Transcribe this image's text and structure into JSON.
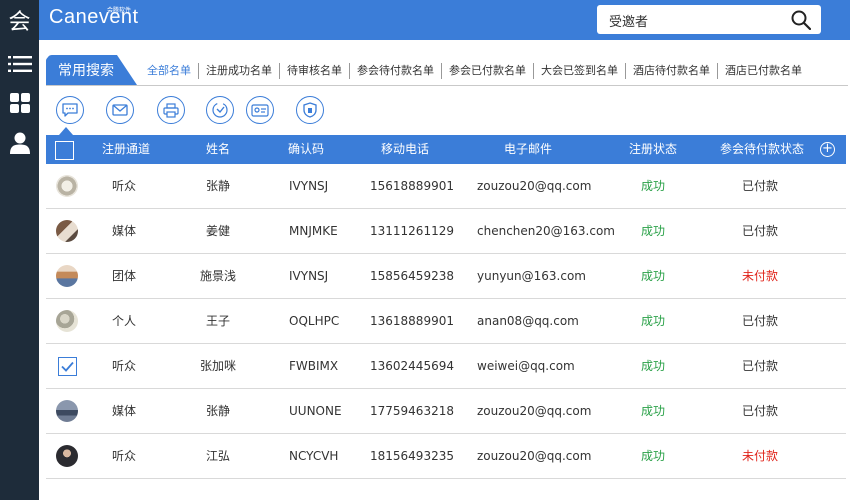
{
  "header": {
    "logo_glyph": "会",
    "brand": "Canevent",
    "brand_sub": "会腾软件",
    "search_value": "受邀者"
  },
  "sidebar": {
    "items": [
      {
        "icon": "list-icon"
      },
      {
        "icon": "grid-icon"
      },
      {
        "icon": "user-icon"
      }
    ]
  },
  "favorites_label": "常用搜索",
  "tabs": [
    {
      "label": "全部名单",
      "active": true
    },
    {
      "label": "注册成功名单"
    },
    {
      "label": "待审核名单"
    },
    {
      "label": "参会待付款名单"
    },
    {
      "label": "参会已付款名单"
    },
    {
      "label": "大会已签到名单"
    },
    {
      "label": "酒店待付款名单"
    },
    {
      "label": "酒店已付款名单"
    }
  ],
  "toolbar": [
    {
      "icon": "message-icon"
    },
    {
      "icon": "mail-icon"
    },
    {
      "icon": "print-icon"
    },
    {
      "icon": "sign-in-icon"
    },
    {
      "icon": "badge-icon"
    },
    {
      "icon": "shield-icon"
    }
  ],
  "table": {
    "columns": [
      "注册通道",
      "姓名",
      "确认码",
      "移动电话",
      "电子邮件",
      "注册状态",
      "参会待付款状态"
    ],
    "add_column_symbol": "+",
    "rows": [
      {
        "channel": "听众",
        "name": "张静",
        "code": "IVYNSJ",
        "phone": "15618889901",
        "email": "zouzou20@qq.com",
        "status": "成功",
        "payment": "已付款",
        "paid": true,
        "checked": false
      },
      {
        "channel": "媒体",
        "name": "姜健",
        "code": "MNJMKE",
        "phone": "13111261129",
        "email": "chenchen20@163.com",
        "status": "成功",
        "payment": "已付款",
        "paid": true,
        "checked": false
      },
      {
        "channel": "团体",
        "name": "施景浅",
        "code": "IVYNSJ",
        "phone": "15856459238",
        "email": "yunyun@163.com",
        "status": "成功",
        "payment": "未付款",
        "paid": false,
        "checked": false
      },
      {
        "channel": "个人",
        "name": "王子",
        "code": "OQLHPC",
        "phone": "13618889901",
        "email": "anan08@qq.com",
        "status": "成功",
        "payment": "已付款",
        "paid": true,
        "checked": false
      },
      {
        "channel": "听众",
        "name": "张加咪",
        "code": "FWBIMX",
        "phone": "13602445694",
        "email": "weiwei@qq.com",
        "status": "成功",
        "payment": "已付款",
        "paid": true,
        "checked": true
      },
      {
        "channel": "媒体",
        "name": "张静",
        "code": "UUNONE",
        "phone": "17759463218",
        "email": "zouzou20@qq.com",
        "status": "成功",
        "payment": "已付款",
        "paid": true,
        "checked": false
      },
      {
        "channel": "听众",
        "name": "江弘",
        "code": "NCYCVH",
        "phone": "18156493235",
        "email": "zouzou20@qq.com",
        "status": "成功",
        "payment": "未付款",
        "paid": false,
        "checked": false
      }
    ]
  },
  "colors": {
    "accent": "#3b7dd8",
    "sidebar": "#1e2c3a",
    "success": "#2aa148",
    "unpaid": "#e0241b"
  }
}
